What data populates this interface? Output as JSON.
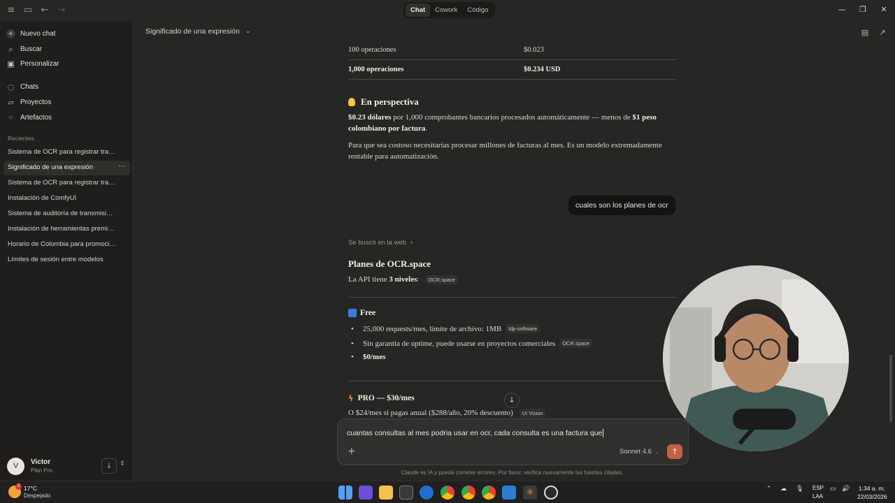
{
  "titlebar": {
    "tabs": [
      {
        "label": "Chat",
        "active": true
      },
      {
        "label": "Cowork",
        "active": false
      },
      {
        "label": "Código",
        "active": false
      }
    ]
  },
  "sidebar": {
    "primary": [
      {
        "label": "Nuevo chat",
        "icon": "plus-icon"
      },
      {
        "label": "Buscar",
        "icon": "search-icon"
      },
      {
        "label": "Personalizar",
        "icon": "customize-icon"
      }
    ],
    "secondary": [
      {
        "label": "Chats",
        "icon": "chat-icon"
      },
      {
        "label": "Proyectos",
        "icon": "folder-icon"
      },
      {
        "label": "Artefactos",
        "icon": "artifacts-icon"
      }
    ],
    "recents_label": "Recientes",
    "recents": [
      "Sistema de OCR para registrar tra…",
      "Significado de una expresión",
      "Sistema de OCR para registrar tra…",
      "Instalación de ComfyUI",
      "Sistema de auditoría de transmisi…",
      "Instalación de herramientas premi…",
      "Horario de Colombia para promoci…",
      "Límites de sesión entre modelos"
    ],
    "active_index": 1,
    "user": {
      "initial": "V",
      "name": "Victor",
      "plan": "Plan Pro"
    }
  },
  "header": {
    "title": "Significado de una expresión"
  },
  "content": {
    "table": [
      {
        "c1": "100 operaciones",
        "c2": "$0.023",
        "bold": false
      },
      {
        "c1": "1,000 operaciones",
        "c2": "$0.234 USD",
        "bold": true
      }
    ],
    "perspective": {
      "heading": "En perspectiva",
      "p1_bold1": "$0.23 dólares",
      "p1_text1": " por 1,000 comprobantes bancarios procesados automáticamente — menos de ",
      "p1_bold2": "$1 peso colombiano por factura",
      "p1_text2": ".",
      "p2": "Para que sea costoso necesitarías procesar millones de facturas al mes. Es un modelo extremadamente rentable para automatización."
    },
    "user_message": "cuales son los planes de ocr",
    "searched": "Se buscó en la web",
    "plans_heading": "Planes de OCR.space",
    "api_text_pre": "La API tiene ",
    "api_text_bold": "3 niveles",
    "api_text_post": ":",
    "api_cite": "OCR.space",
    "free": {
      "heading": "Free",
      "bullets": [
        {
          "text": "25,000 requests/mes, límite de archivo: 1MB",
          "cite": "ldp-software",
          "bold": false
        },
        {
          "text": "Sin garantía de uptime, puede usarse en proyectos comerciales",
          "cite": "OCR.space",
          "bold": false
        },
        {
          "text": "$0/mes",
          "cite": "",
          "bold": true
        }
      ]
    },
    "pro": {
      "heading": "PRO — $30/mes",
      "line": "O $24/mes si pagas anual ($288/año, 20% descuento)",
      "cite": "UI Vision"
    }
  },
  "composer": {
    "text": "cuantas consultas al mes podria usar en ocr, cada consulta es una factura que",
    "model": "Sonnet 4.6"
  },
  "disclaimer": "Claude es IA y puede cometer errores. Por favor, verifica nuevamente las fuentes citadas.",
  "taskbar": {
    "weather_badge": "3",
    "temp": "17°C",
    "weather": "Despejado",
    "lang1": "ESP",
    "lang2": "LAA",
    "time": "1:34 a. m.",
    "date": "22/03/2026"
  },
  "colors": {
    "background": "#262624",
    "sidebar": "#1f1e1d",
    "accent": "#c6613f"
  }
}
